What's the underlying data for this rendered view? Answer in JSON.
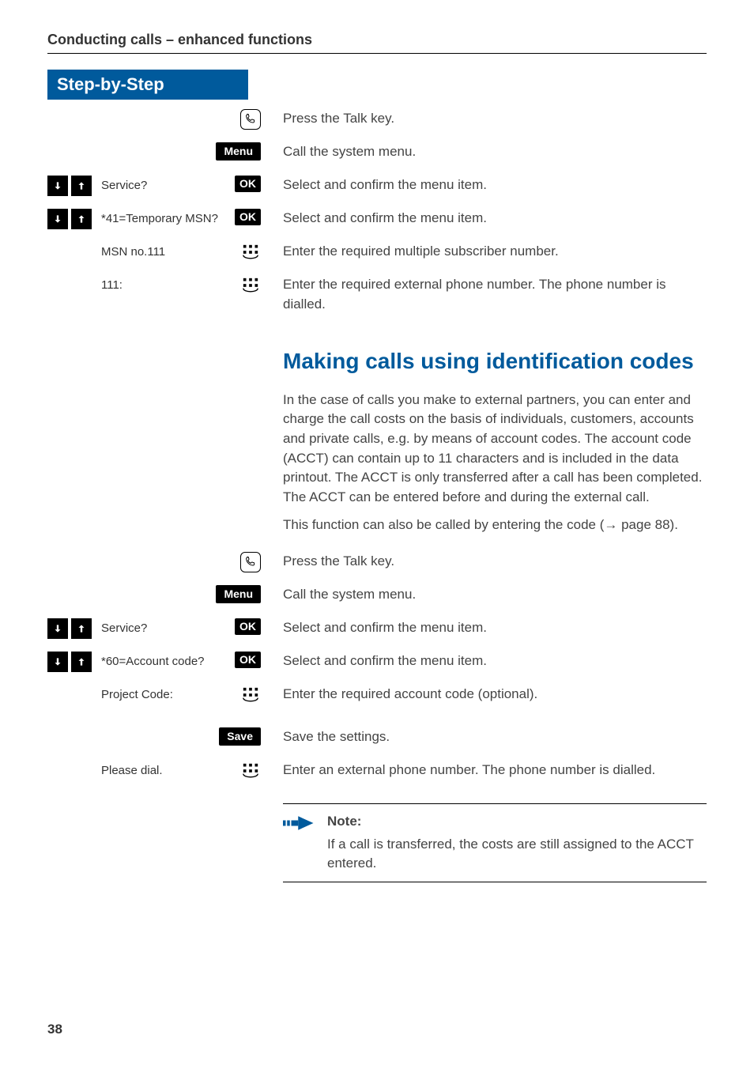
{
  "header": "Conducting calls – enhanced functions",
  "side_header": "Step-by-Step",
  "page_number": "38",
  "section1": {
    "rows": [
      {
        "left_type": "talk",
        "right": "Press the Talk key."
      },
      {
        "left_type": "menu",
        "menu_label": "Menu",
        "right": "Call the system menu."
      },
      {
        "left_type": "navok",
        "center": "Service?",
        "ok": "OK",
        "right": "Select and confirm the menu item."
      },
      {
        "left_type": "navok",
        "center": "*41=Temporary MSN?",
        "ok": "OK",
        "right": "Select and confirm the menu item."
      },
      {
        "left_type": "keypad_text",
        "center": "MSN no.111",
        "right": "Enter the required multiple subscriber number."
      },
      {
        "left_type": "keypad_text",
        "center": "111:",
        "right": "Enter the required external phone number. The phone number is dialled."
      }
    ]
  },
  "section2": {
    "title": "Making calls using identification codes",
    "intro1": "In the case of calls you make to external partners, you can enter and charge the call costs on the basis of individuals, customers, accounts and private calls, e.g.  by means of account codes. The account code (ACCT) can contain up to 11 characters and is included in the data printout. The ACCT is only transferred after a call has been completed. The ACCT can be entered before and during the external call.",
    "intro2_prefix": "This function can also be called by entering the code (",
    "intro2_arrow": "→",
    "intro2_page": " page 88).",
    "rows": [
      {
        "left_type": "talk",
        "right": "Press the Talk key."
      },
      {
        "left_type": "menu",
        "menu_label": "Menu",
        "right": "Call the system menu."
      },
      {
        "left_type": "navok",
        "center": "Service?",
        "ok": "OK",
        "right": "Select and confirm the menu item."
      },
      {
        "left_type": "navok",
        "center": "*60=Account code?",
        "ok": "OK",
        "right": "Select and confirm the menu item."
      },
      {
        "left_type": "keypad_text",
        "center": "Project Code:",
        "right": "Enter the required account code (optional)."
      },
      {
        "left_type": "menu",
        "menu_label": "Save",
        "right": "Save the settings."
      },
      {
        "left_type": "keypad_text",
        "center": "Please dial.",
        "right": "Enter an external phone number. The phone number is dialled."
      }
    ],
    "note": {
      "title": "Note:",
      "body": "If a call is transferred, the costs are still assigned to the ACCT entered."
    }
  }
}
